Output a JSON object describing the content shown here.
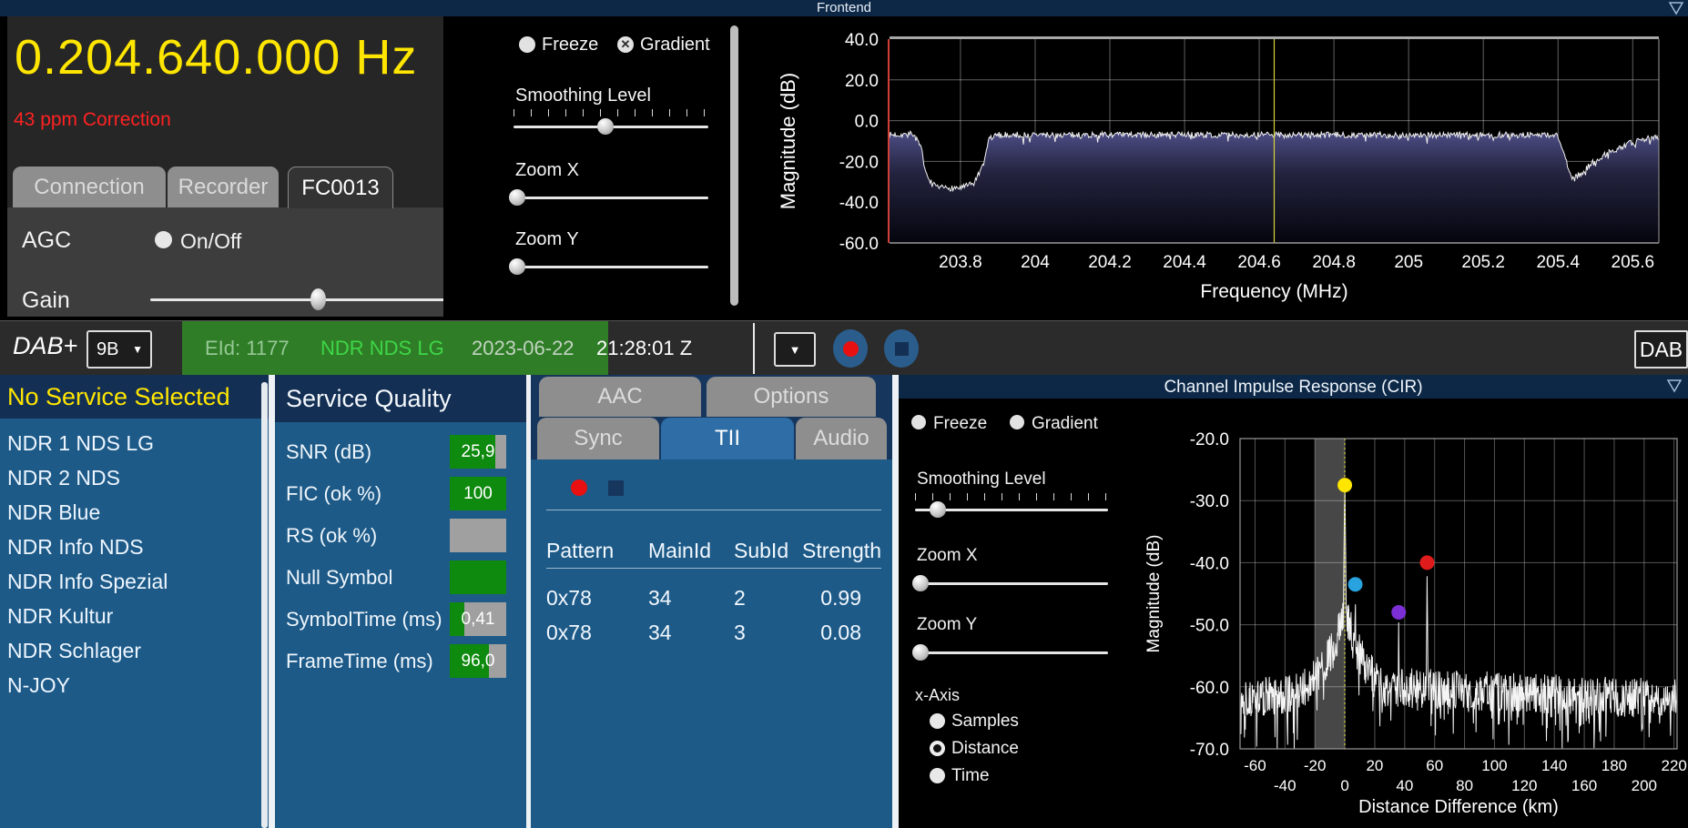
{
  "frontend": {
    "title": "Frontend",
    "frequency": "0.204.640.000 Hz",
    "correction": "43 ppm Correction",
    "tabs": [
      "Connection",
      "Recorder",
      "FC0013"
    ],
    "active_tab": "FC0013",
    "agc_label": "AGC",
    "agc_toggle": "On/Off",
    "agc_checked": false,
    "gain_label": "Gain",
    "gain_value": 56,
    "controls": {
      "freeze": "Freeze",
      "freeze_checked": false,
      "gradient": "Gradient",
      "gradient_checked": true,
      "smoothing": "Smoothing Level",
      "smoothing_value": 47,
      "zoom_x": "Zoom X",
      "zoom_x_value": 2,
      "zoom_y": "Zoom Y",
      "zoom_y_value": 2
    }
  },
  "dab_bar": {
    "mode": "DAB+",
    "channel": "9B",
    "eid": "EId: 1177",
    "ensemble": "NDR NDS LG",
    "date": "2023-06-22",
    "time": "21:28:01 Z",
    "badge": "DAB"
  },
  "service_list": {
    "header": "No Service Selected",
    "services": [
      "NDR 1 NDS LG",
      "NDR 2 NDS",
      "NDR Blue",
      "NDR Info NDS",
      "NDR Info Spezial",
      "NDR Kultur",
      "NDR Schlager",
      "N-JOY"
    ]
  },
  "service_quality": {
    "header": "Service Quality",
    "rows": [
      {
        "label": "SNR (dB)",
        "value": "25,9",
        "fill": 0.8
      },
      {
        "label": "FIC (ok %)",
        "value": "100",
        "fill": 1.0
      },
      {
        "label": "RS (ok %)",
        "value": "",
        "fill": 0.0
      },
      {
        "label": "Null Symbol",
        "value": "",
        "fill": 1.0
      },
      {
        "label": "SymbolTime (ms)",
        "value": "0,41",
        "fill": 0.25
      },
      {
        "label": "FrameTime (ms)",
        "value": "96,0",
        "fill": 0.7
      }
    ]
  },
  "tii": {
    "tabs_row1": [
      "AAC",
      "Options"
    ],
    "tabs_row2": [
      "Sync",
      "TII",
      "Audio"
    ],
    "active_tab": "TII",
    "columns": [
      "Pattern",
      "MainId",
      "SubId",
      "Strength"
    ],
    "rows": [
      [
        "0x78",
        "34",
        "2",
        "0.99"
      ],
      [
        "0x78",
        "34",
        "3",
        "0.08"
      ]
    ]
  },
  "cir": {
    "title": "Channel Impulse Response (CIR)",
    "controls": {
      "freeze": "Freeze",
      "freeze_checked": false,
      "gradient": "Gradient",
      "gradient_checked": false,
      "smoothing": "Smoothing Level",
      "smoothing_value": 12,
      "zoom_x": "Zoom X",
      "zoom_x_value": 3,
      "zoom_y": "Zoom Y",
      "zoom_y_value": 3
    },
    "x_axis_label": "x-Axis",
    "x_axis_options": [
      "Samples",
      "Distance",
      "Time"
    ],
    "x_axis_selected": "Distance"
  },
  "colors": {
    "accent_yellow": "#ffe600",
    "alert_red": "#ff2222",
    "navy_header": "#0d2847",
    "panel_blue": "#1d5a87",
    "section_navy": "#132f54",
    "quality_green": "#0e8a0e",
    "eid_green": "#2f7d26",
    "tab_gray": "#8e8e8e",
    "active_tab_blue": "#2e6da6",
    "record_red": "#e81010",
    "steel_blue": "#2b5d8c",
    "marker_yellow": "#ffe600",
    "marker_cyan": "#29a3e0",
    "marker_purple": "#7b2fd4",
    "marker_red": "#e01b1b"
  },
  "chart_data": [
    {
      "type": "line",
      "name": "frontend-spectrum",
      "title": "Frontend",
      "xlabel": "Frequency (MHz)",
      "ylabel": "Magnitude (dB)",
      "xlim": [
        203.61,
        205.67
      ],
      "ylim": [
        -60,
        40
      ],
      "yticks": [
        [
          "40.0",
          40
        ],
        [
          "20.0",
          20
        ],
        [
          "0.0",
          0
        ],
        [
          "-20.0",
          -20
        ],
        [
          "-40.0",
          -40
        ],
        [
          "-60.0",
          -60
        ]
      ],
      "xticks": [
        [
          "203.8",
          203.8
        ],
        [
          "204",
          204
        ],
        [
          "204.2",
          204.2
        ],
        [
          "204.4",
          204.4
        ],
        [
          "204.6",
          204.6
        ],
        [
          "204.8",
          204.8
        ],
        [
          "205",
          205
        ],
        [
          "205.2",
          205.2
        ],
        [
          "205.4",
          205.4
        ],
        [
          "205.6",
          205.6
        ]
      ],
      "grid": true,
      "center_marker_mhz": 204.64,
      "noise_db": 1.5,
      "envelope": [
        [
          203.61,
          -7
        ],
        [
          203.675,
          -6.5
        ],
        [
          203.695,
          -14
        ],
        [
          203.71,
          -28
        ],
        [
          203.735,
          -33
        ],
        [
          203.8,
          -33
        ],
        [
          203.835,
          -31
        ],
        [
          203.862,
          -22
        ],
        [
          203.875,
          -9
        ],
        [
          203.9,
          -7
        ],
        [
          205.4,
          -7
        ],
        [
          205.425,
          -22
        ],
        [
          205.44,
          -29
        ],
        [
          205.46,
          -26
        ],
        [
          205.49,
          -21
        ],
        [
          205.53,
          -16
        ],
        [
          205.58,
          -12
        ],
        [
          205.63,
          -9
        ],
        [
          205.67,
          -8
        ]
      ]
    },
    {
      "type": "line",
      "name": "channel-impulse-response",
      "title": "Channel Impulse Response (CIR)",
      "xlabel": "Distance Difference (km)",
      "ylabel": "Magnitude (dB)",
      "xlim": [
        -70,
        222
      ],
      "ylim": [
        -70,
        -20
      ],
      "yticks": [
        [
          "-20.0",
          -20
        ],
        [
          "-30.0",
          -30
        ],
        [
          "-40.0",
          -40
        ],
        [
          "-50.0",
          -50
        ],
        [
          "-60.0",
          -60
        ],
        [
          "-70.0",
          -70
        ]
      ],
      "xticks_row1": [
        [
          "-60",
          -60
        ],
        [
          "-20",
          -20
        ],
        [
          "20",
          20
        ],
        [
          "60",
          60
        ],
        [
          "100",
          100
        ],
        [
          "140",
          140
        ],
        [
          "180",
          180
        ],
        [
          "220",
          220
        ]
      ],
      "xticks_row2": [
        [
          "-40",
          -40
        ],
        [
          "0",
          0
        ],
        [
          "40",
          40
        ],
        [
          "80",
          80
        ],
        [
          "120",
          120
        ],
        [
          "160",
          160
        ],
        [
          "200",
          200
        ]
      ],
      "grid": true,
      "shaded_band_km": [
        -20,
        0
      ],
      "vline_km": 0,
      "noise_floor_db": -62,
      "floor_envelope": [
        [
          -70,
          -62
        ],
        [
          -30,
          -61
        ],
        [
          -18,
          -58
        ],
        [
          -8,
          -54
        ],
        [
          -3,
          -50
        ],
        [
          0,
          -48
        ],
        [
          3,
          -50
        ],
        [
          8,
          -54
        ],
        [
          15,
          -57
        ],
        [
          25,
          -60
        ],
        [
          222,
          -62
        ]
      ],
      "peaks": [
        {
          "x": 0,
          "y": -26.5,
          "w": 0.9
        },
        {
          "x": 7,
          "y": -44.5,
          "w": 0.8
        },
        {
          "x": 36,
          "y": -49.5,
          "w": 0.7
        },
        {
          "x": 55,
          "y": -41.5,
          "w": 0.7
        }
      ],
      "markers": [
        {
          "x": 0,
          "y": -27.5,
          "color": "#ffe600",
          "name": "main-transmitter-marker"
        },
        {
          "x": 7,
          "y": -43.5,
          "color": "#29a3e0",
          "name": "echo-marker-cyan"
        },
        {
          "x": 36,
          "y": -48.0,
          "color": "#7b2fd4",
          "name": "echo-marker-purple"
        },
        {
          "x": 55,
          "y": -40.0,
          "color": "#e01b1b",
          "name": "echo-marker-red"
        }
      ]
    }
  ]
}
